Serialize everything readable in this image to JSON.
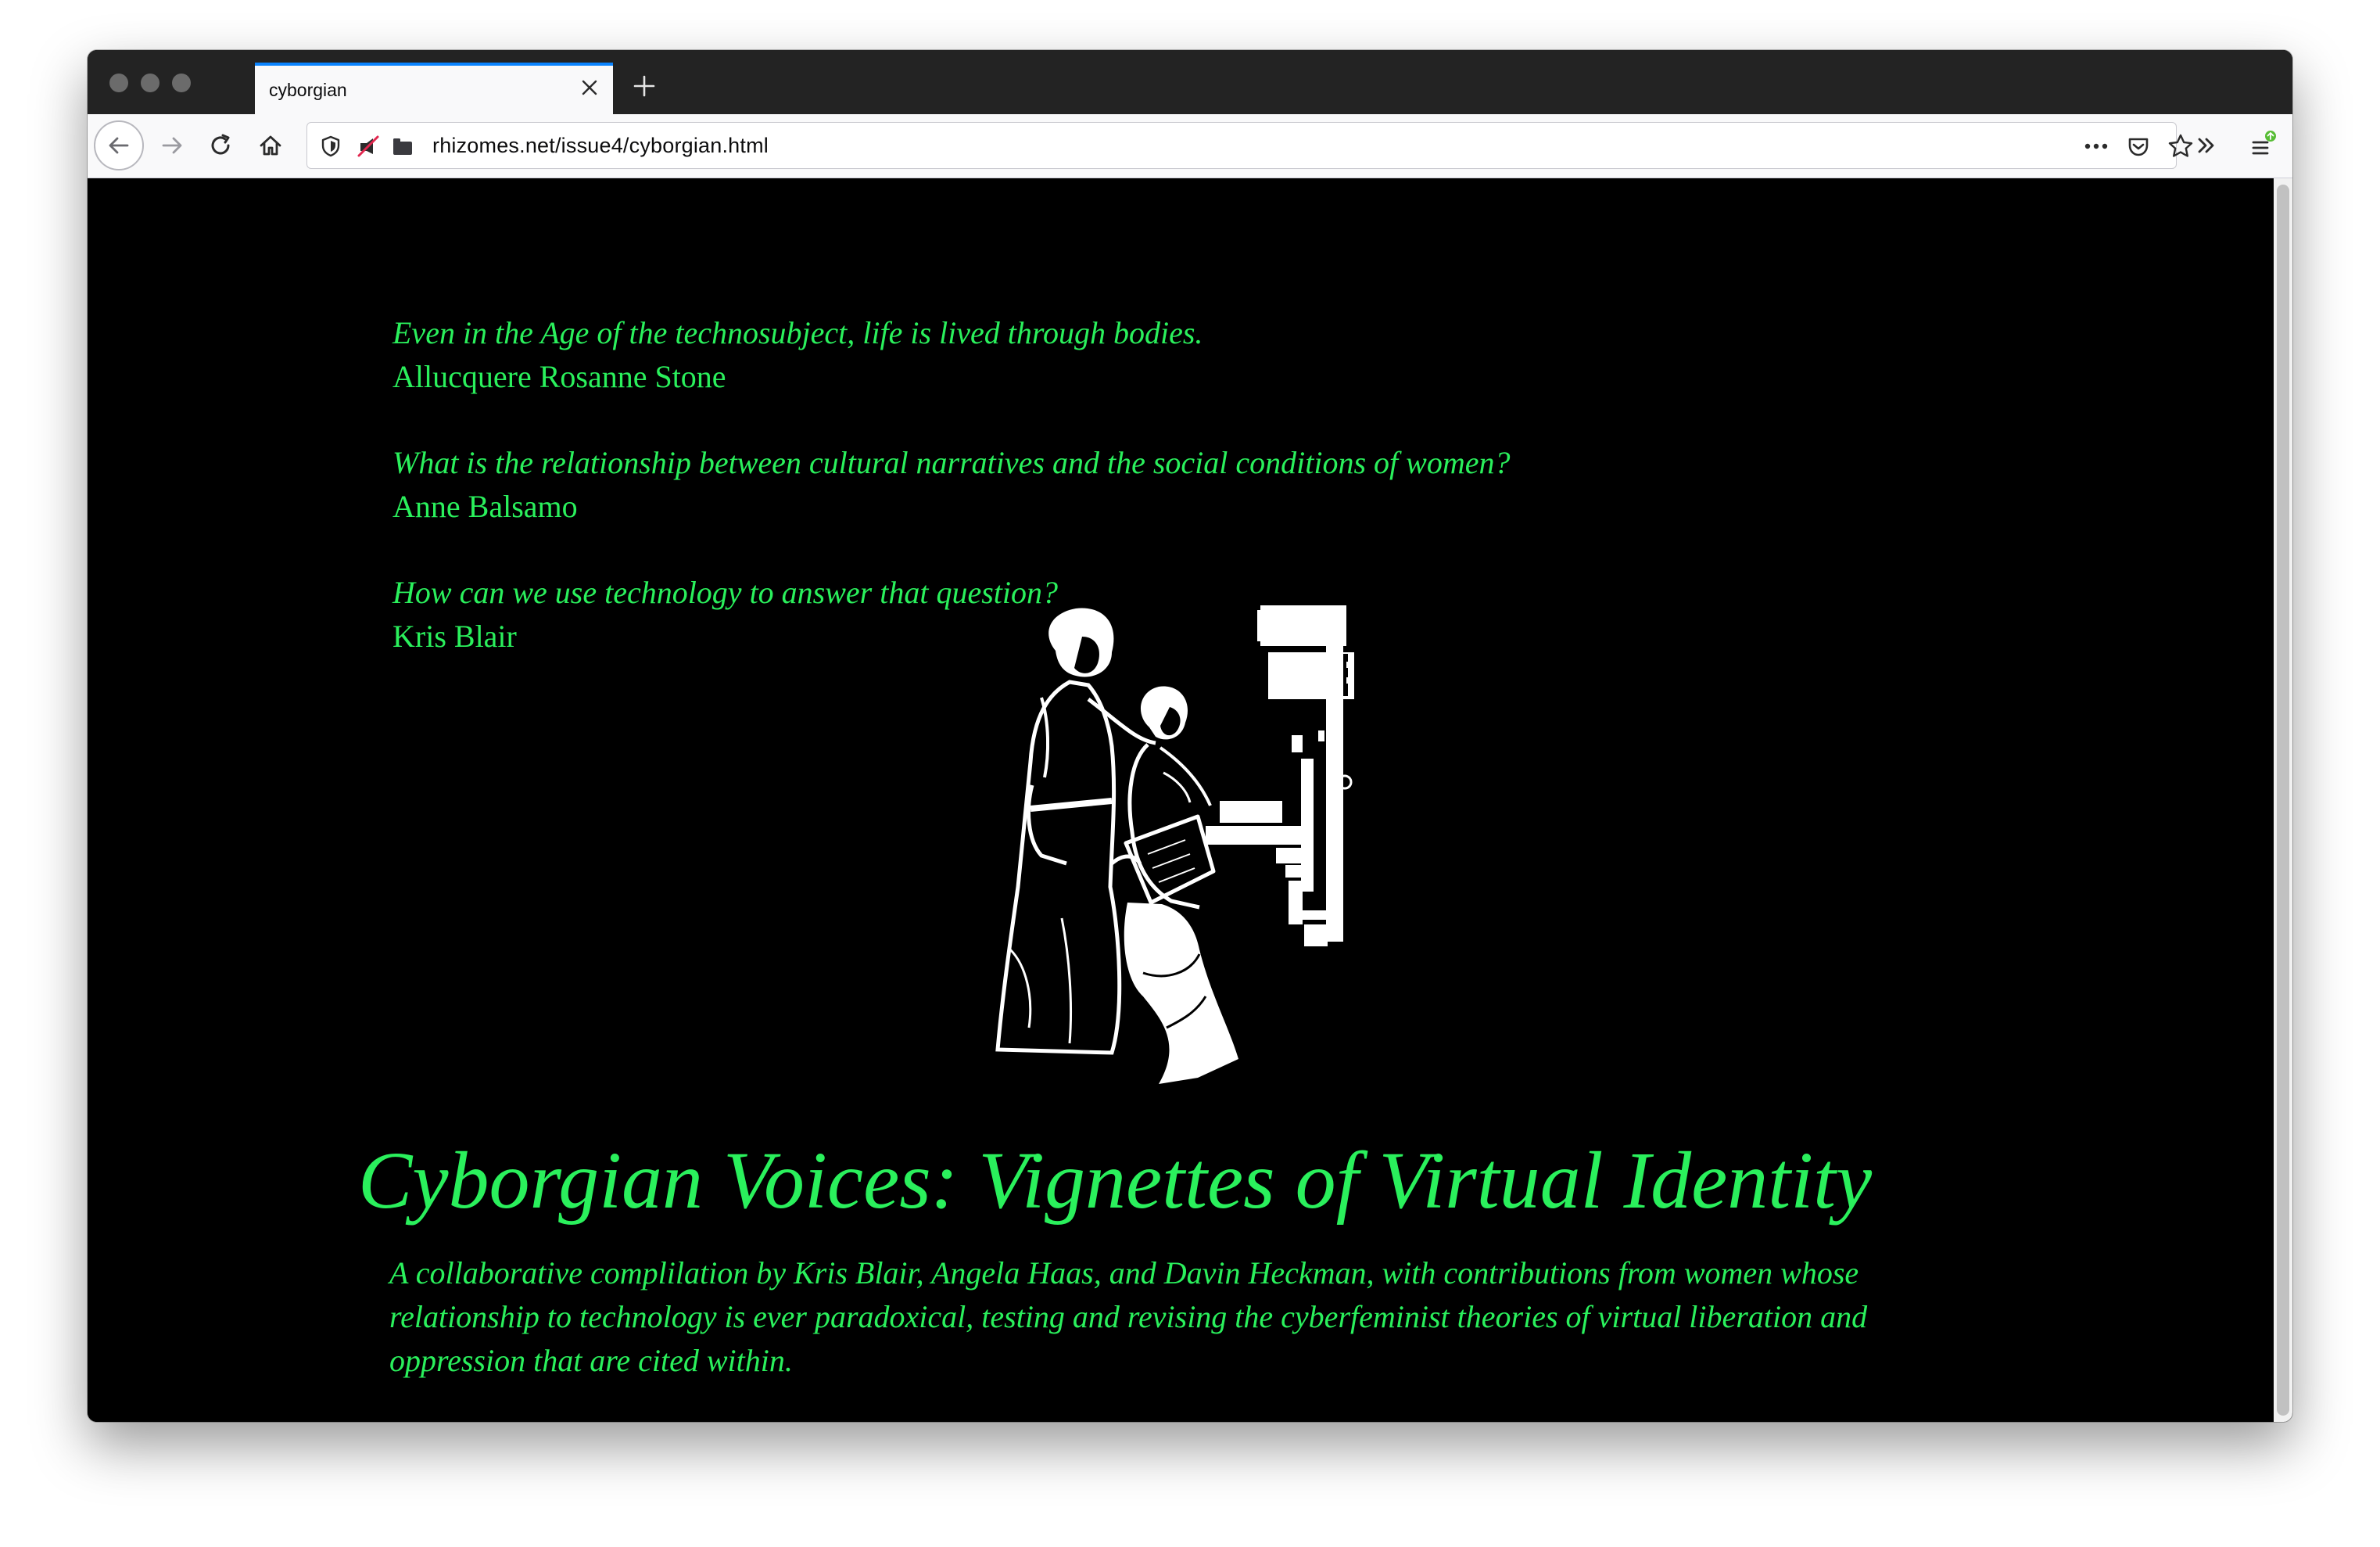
{
  "browser": {
    "tab_title": "cyborgian",
    "url": "rhizomes.net/issue4/cyborgian.html"
  },
  "page": {
    "quotes": [
      {
        "text": "Even in the Age of the technosubject, life is lived through bodies.",
        "author": "Allucquere Rosanne Stone"
      },
      {
        "text": "What is the relationship between cultural narratives and the social conditions of women?",
        "author": "Anne Balsamo"
      },
      {
        "text": "How can we use technology to answer that question?",
        "author": "Kris Blair"
      }
    ],
    "title": "Cyborgian Voices: Vignettes of Virtual Identity",
    "description": "A collaborative complilation by Kris Blair, Angela Haas, and Davin Heckman, with contributions from women whose relationship to technology is ever paradoxical, testing and revising the cyberfeminist theories of virtual liberation and oppression that are cited within."
  },
  "colors": {
    "text_green": "#2af05c",
    "page_background": "#000000",
    "tab_accent": "#0a84ff",
    "update_badge": "#57bd35"
  },
  "icons": {
    "back": "arrow-left-icon",
    "forward": "arrow-right-icon",
    "reload": "reload-icon",
    "home": "home-icon",
    "shield": "tracking-shield-icon",
    "blocked": "autoplay-blocked-icon",
    "page_info": "page-info-icon",
    "more": "ellipsis-icon",
    "pocket": "pocket-icon",
    "bookmark": "star-icon",
    "overflow": "double-chevron-icon",
    "menu": "hamburger-menu-icon"
  }
}
